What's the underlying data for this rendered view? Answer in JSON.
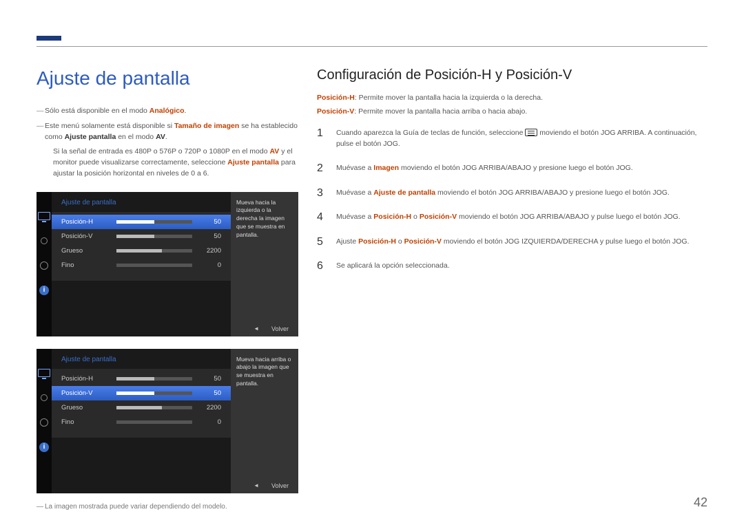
{
  "header": {
    "main_title": "Ajuste de pantalla",
    "notes": {
      "n1_pre": "Sólo está disponible en el modo ",
      "n1_bold": "Analógico",
      "n1_post": ".",
      "n2_pre": "Este menú solamente está disponible si ",
      "n2_b1": "Tamaño de imagen",
      "n2_mid": " se ha establecido como ",
      "n2_b2": "Ajuste pantalla",
      "n2_mid2": " en el modo ",
      "n2_b3": "AV",
      "n2_post": ".",
      "sub_pre": "Si la señal de entrada es 480P o 576P o 720P o 1080P en el modo ",
      "sub_b1": "AV",
      "sub_mid": " y el monitor puede visualizarse correctamente, seleccione ",
      "sub_b2": "Ajuste pantalla",
      "sub_post": " para ajustar la posición horizontal en niveles de 0 a 6."
    }
  },
  "panel1": {
    "title": "Ajuste de pantalla",
    "rows": [
      {
        "label": "Posición-H",
        "value": "50",
        "fill": 50,
        "selected": true
      },
      {
        "label": "Posición-V",
        "value": "50",
        "fill": 50,
        "selected": false
      },
      {
        "label": "Grueso",
        "value": "2200",
        "fill": 60,
        "selected": false
      },
      {
        "label": "Fino",
        "value": "0",
        "fill": 0,
        "selected": false
      }
    ],
    "hint": "Mueva hacia la izquierda o la derecha la imagen que se muestra en pantalla.",
    "footer_volver": "Volver"
  },
  "panel2": {
    "title": "Ajuste de pantalla",
    "rows": [
      {
        "label": "Posición-H",
        "value": "50",
        "fill": 50,
        "selected": false
      },
      {
        "label": "Posición-V",
        "value": "50",
        "fill": 50,
        "selected": true
      },
      {
        "label": "Grueso",
        "value": "2200",
        "fill": 60,
        "selected": false
      },
      {
        "label": "Fino",
        "value": "0",
        "fill": 0,
        "selected": false
      }
    ],
    "hint": "Mueva hacia arriba o abajo la imagen que se muestra en pantalla.",
    "footer_volver": "Volver"
  },
  "caption": "La imagen mostrada puede variar dependiendo del modelo.",
  "right": {
    "title": "Configuración de Posición-H y Posición-V",
    "posH_label": "Posición-H",
    "posH_desc": ": Permite mover la pantalla hacia la izquierda o la derecha.",
    "posV_label": "Posición-V",
    "posV_desc": ": Permite mover la pantalla hacia arriba o hacia abajo.",
    "steps": {
      "s1_a": "Cuando aparezca la Guía de teclas de función, seleccione ",
      "s1_b": " moviendo el botón JOG ARRIBA. A continuación, pulse el botón JOG.",
      "s2_a": "Muévase a ",
      "s2_bold": "Imagen",
      "s2_b": " moviendo el botón JOG ARRIBA/ABAJO y presione luego el botón JOG.",
      "s3_a": "Muévase a ",
      "s3_bold": "Ajuste de pantalla",
      "s3_b": " moviendo el botón JOG ARRIBA/ABAJO y presione luego el botón JOG.",
      "s4_a": "Muévase a ",
      "s4_b1": "Posición-H",
      "s4_mid": " o ",
      "s4_b2": "Posición-V",
      "s4_b": " moviendo el botón JOG ARRIBA/ABAJO y pulse luego el botón JOG.",
      "s5_a": "Ajuste ",
      "s5_b1": "Posición-H",
      "s5_mid": " o ",
      "s5_b2": "Posición-V",
      "s5_b": " moviendo el botón JOG IZQUIERDA/DERECHA y pulse luego el botón JOG.",
      "s6": "Se aplicará la opción seleccionada."
    }
  },
  "page_number": "42",
  "info_glyph": "i"
}
